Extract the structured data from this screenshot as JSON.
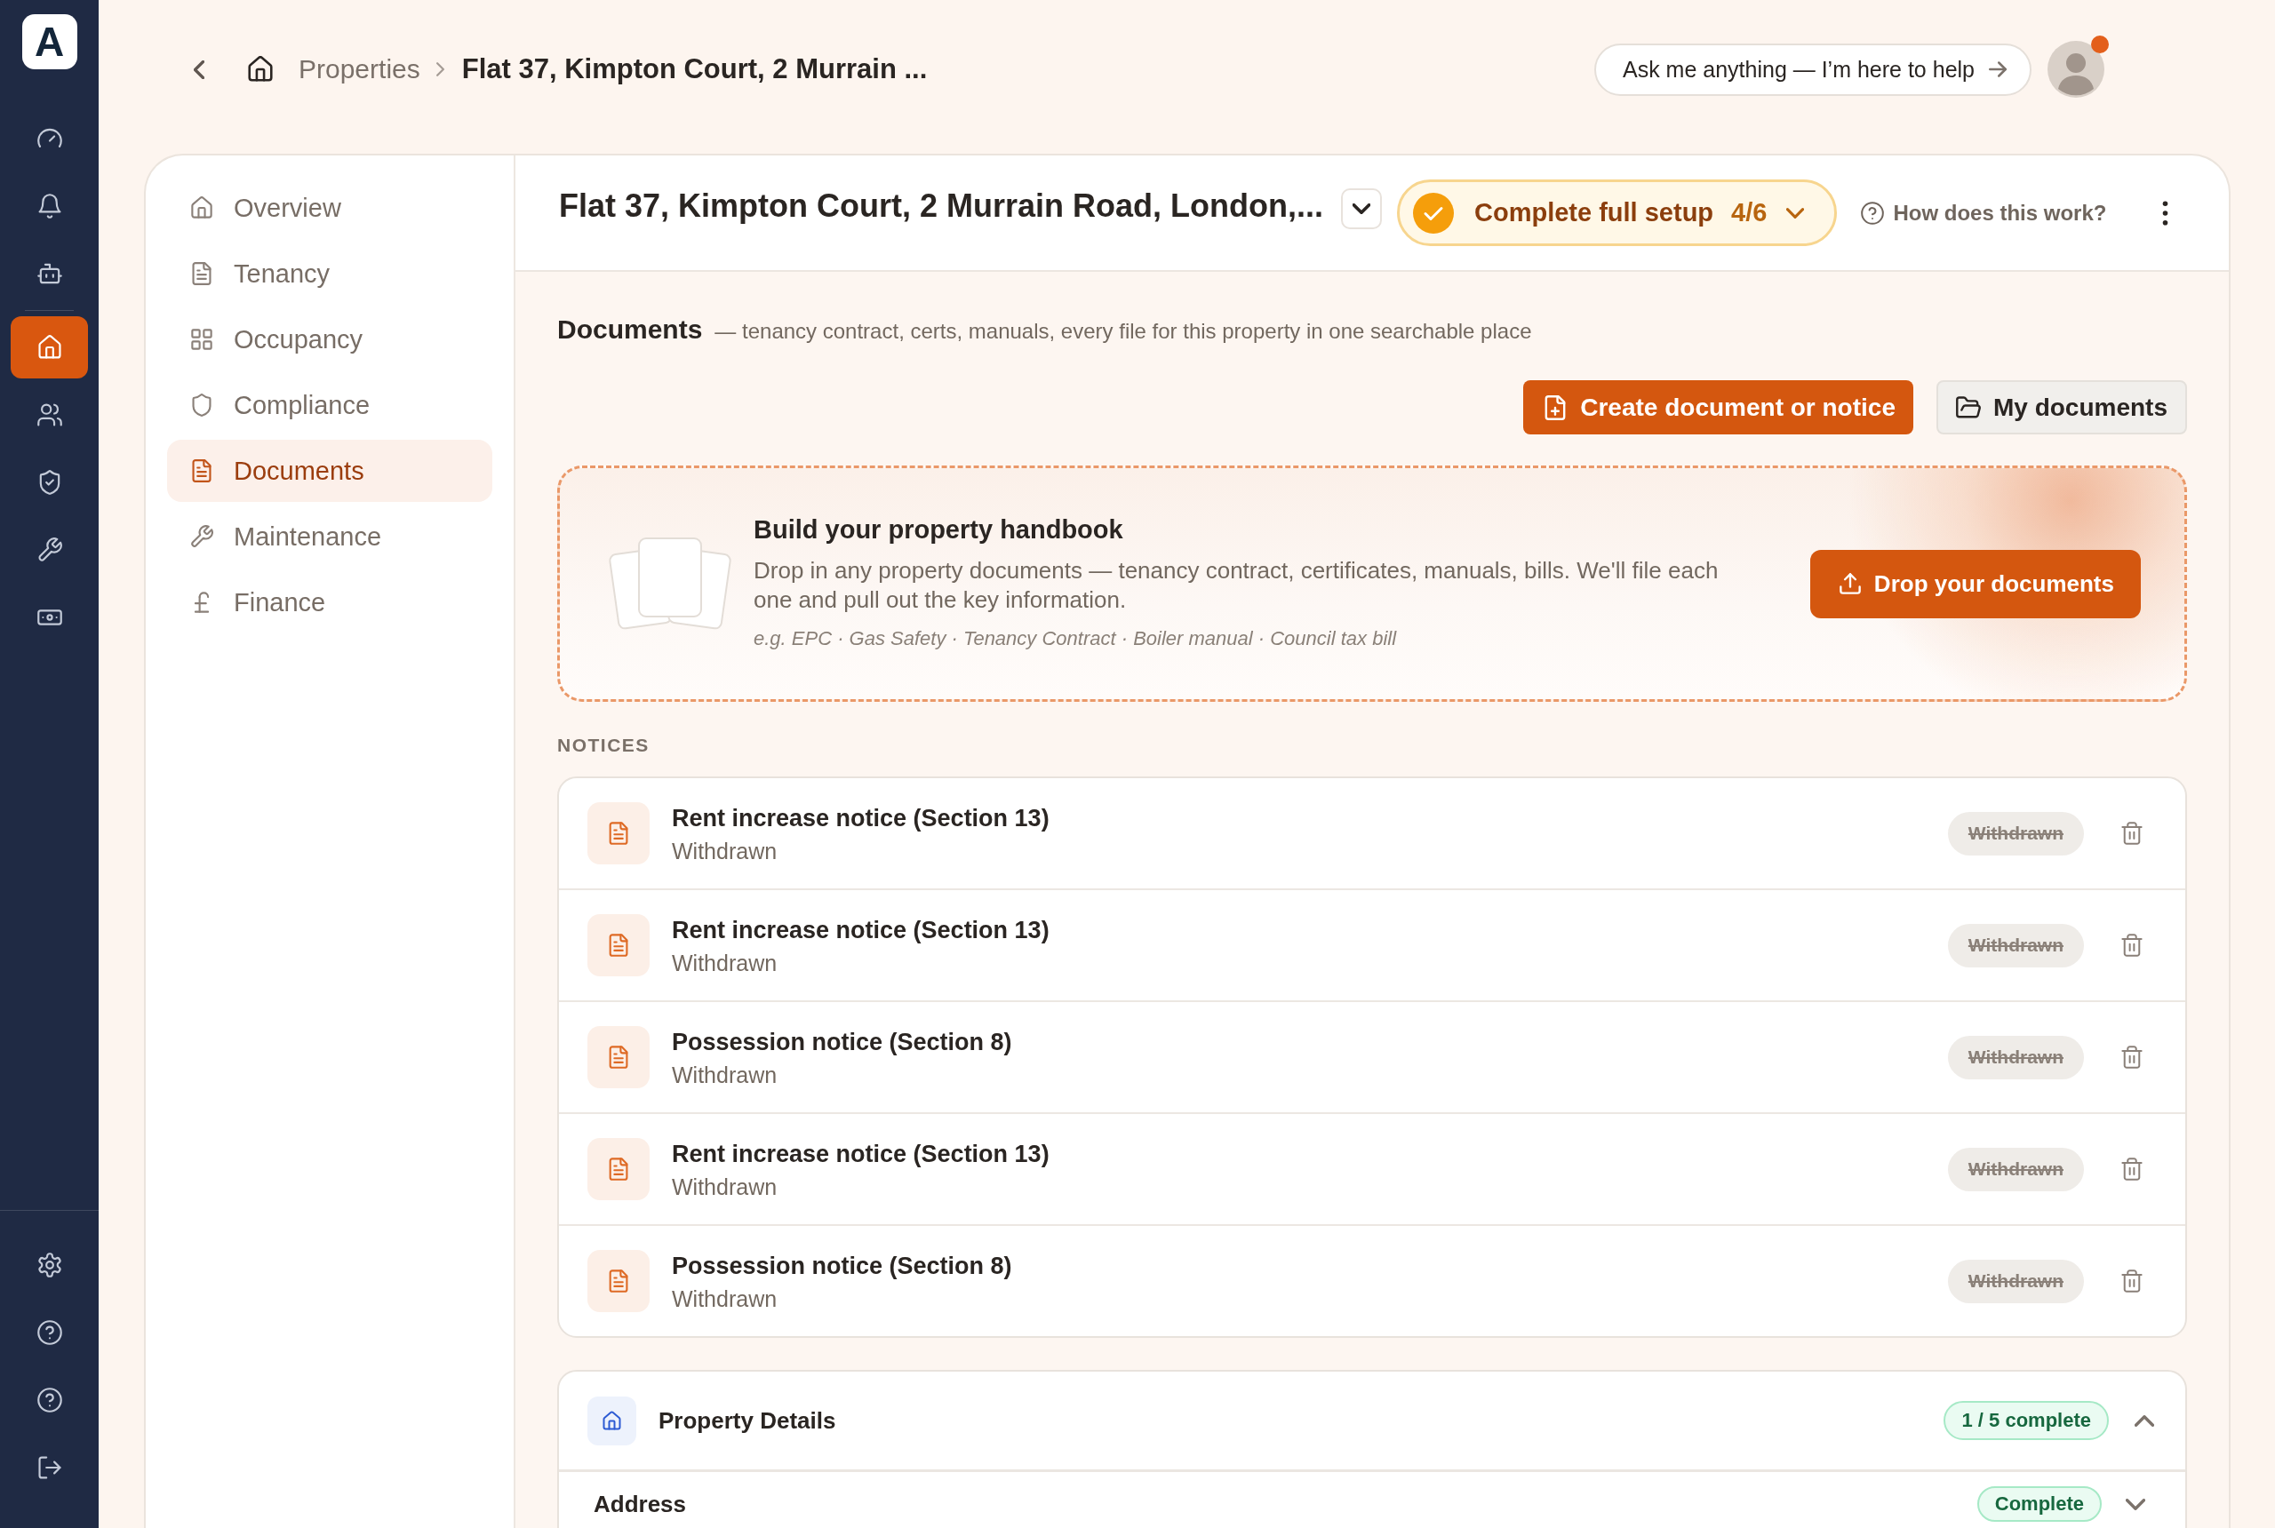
{
  "rail": {
    "logo": "A",
    "items": [
      {
        "selected": false
      },
      {
        "selected": false
      },
      {
        "selected": false
      },
      {
        "selected": true
      },
      {
        "selected": false
      },
      {
        "selected": false
      },
      {
        "selected": false
      },
      {
        "selected": false
      }
    ]
  },
  "top_bar": {
    "breadcrumb": {
      "parent": "Properties",
      "current": "Flat 37, Kimpton Court, 2 Murrain ..."
    },
    "assistant_prompt": "Ask me anything — I’m here to help",
    "avatar": {
      "notification": true
    }
  },
  "nav": {
    "items": [
      {
        "label": "Overview",
        "selected": false
      },
      {
        "label": "Tenancy",
        "selected": false
      },
      {
        "label": "Occupancy",
        "selected": false
      },
      {
        "label": "Compliance",
        "selected": false
      },
      {
        "label": "Documents",
        "selected": true
      },
      {
        "label": "Maintenance",
        "selected": false
      },
      {
        "label": "Finance",
        "selected": false
      }
    ]
  },
  "header": {
    "title": "Flat 37, Kimpton Court, 2 Murrain Road, London,...",
    "setup": {
      "label": "Complete full setup",
      "progress": "4/6"
    },
    "help": "How does this work?"
  },
  "documents": {
    "title": "Documents",
    "description": "— tenancy contract, certs, manuals, every file for this property in one searchable place",
    "actions": [
      {
        "label": "Create document or notice",
        "kind": "primary"
      },
      {
        "label": "My documents",
        "kind": "secondary"
      }
    ],
    "dropzone": {
      "title": "Build your property handbook",
      "description": "Drop in any property documents — tenancy contract, certificates, manuals, bills. We'll file each one and pull out the key information.",
      "examples": "e.g. EPC · Gas Safety · Tenancy Contract · Boiler manual · Council tax bill",
      "button": "Drop your documents"
    }
  },
  "notices": {
    "heading": "NOTICES",
    "items": [
      {
        "title": "Rent increase notice (Section 13)",
        "subtitle": "Withdrawn",
        "status": "Withdrawn",
        "withdrawn": true
      },
      {
        "title": "Rent increase notice (Section 13)",
        "subtitle": "Withdrawn",
        "status": "Withdrawn",
        "withdrawn": true
      },
      {
        "title": "Possession notice (Section 8)",
        "subtitle": "Withdrawn",
        "status": "Withdrawn",
        "withdrawn": true
      },
      {
        "title": "Rent increase notice (Section 13)",
        "subtitle": "Withdrawn",
        "status": "Withdrawn",
        "withdrawn": true
      },
      {
        "title": "Possession notice (Section 8)",
        "subtitle": "Withdrawn",
        "status": "Withdrawn",
        "withdrawn": true
      }
    ]
  },
  "property_details": {
    "title": "Property Details",
    "progress": "1 / 5 complete",
    "expanded": true,
    "fields": [
      {
        "label": "Address",
        "status": "Complete",
        "expanded": false
      }
    ]
  }
}
